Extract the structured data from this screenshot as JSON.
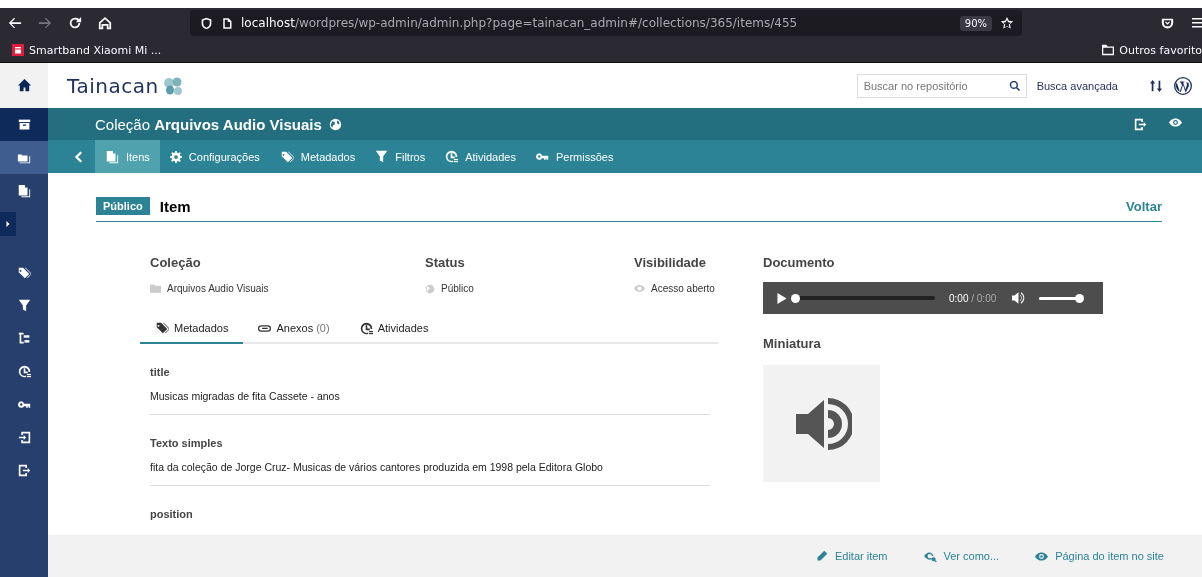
{
  "browser": {
    "url_host": "localhost",
    "url_path": "/wordpres/wp-admin/admin.php?page=tainacan_admin#/collections/365/items/455",
    "zoom": "90%",
    "bookmark": "Smartband Xiaomi Mi ...",
    "other_bookmarks": "Outros favorito"
  },
  "sidebar": {
    "items": [
      {
        "kind": "home",
        "selected": false
      },
      {
        "kind": "heading",
        "selected": false
      },
      {
        "kind": "link",
        "selected": true
      },
      {
        "kind": "link",
        "selected": false
      },
      {
        "kind": "toggle",
        "selected": false
      },
      {
        "kind": "link",
        "selected": false
      },
      {
        "kind": "link",
        "selected": false
      },
      {
        "kind": "link",
        "selected": false
      },
      {
        "kind": "link",
        "selected": false
      },
      {
        "kind": "link",
        "selected": false
      },
      {
        "kind": "link",
        "selected": false
      },
      {
        "kind": "link",
        "selected": false
      }
    ]
  },
  "header": {
    "logo": "Tainacan",
    "search": {
      "placeholder": "Buscar no repositório"
    },
    "advanced_search": "Busca avançada"
  },
  "collection_bar": {
    "title": "Coleção **Arquivos Audio Visuais**"
  },
  "nav_tabs": [
    {
      "label": "Itens",
      "selected": true
    },
    {
      "label": "Configurações",
      "selected": false
    },
    {
      "label": "Metadados",
      "selected": false
    },
    {
      "label": "Filtros",
      "selected": false
    },
    {
      "label": "Atividades",
      "selected": false
    },
    {
      "label": "Permissões",
      "selected": false
    }
  ],
  "item": {
    "status_badge": "Público",
    "title": "Item",
    "back": "Voltar"
  },
  "info": [
    {
      "label": "Coleção",
      "value": "Arquivos Audio Visuais"
    },
    {
      "label": "Status",
      "value": "Público"
    },
    {
      "label": "Visibilidade",
      "value": "Acesso aberto"
    }
  ],
  "item_tabs": [
    {
      "label": "Metadados",
      "selected": true
    },
    {
      "label": "Anexos",
      "count": "(0)",
      "selected": false
    },
    {
      "label": "Atividades",
      "selected": false
    }
  ],
  "metadata": [
    {
      "label": "title",
      "value": "Musicas migradas de fita Cassete - anos"
    },
    {
      "label": "Texto simples",
      "value": "fita da coleção de Jorge Cruz- Musicas de vários cantores produzida em 1998 pela Editora Globo"
    },
    {
      "label": "position"
    }
  ],
  "document": {
    "label": "Documento",
    "player": {
      "time": "0:00",
      "duration": "/ 0:00",
      "progress": {
        "level": 0
      },
      "volume": {
        "level": 1
      }
    },
    "thumbnail_label": "Miniatura"
  },
  "footer": [
    "Editar item",
    "Ver como...",
    "Página do item no site"
  ]
}
